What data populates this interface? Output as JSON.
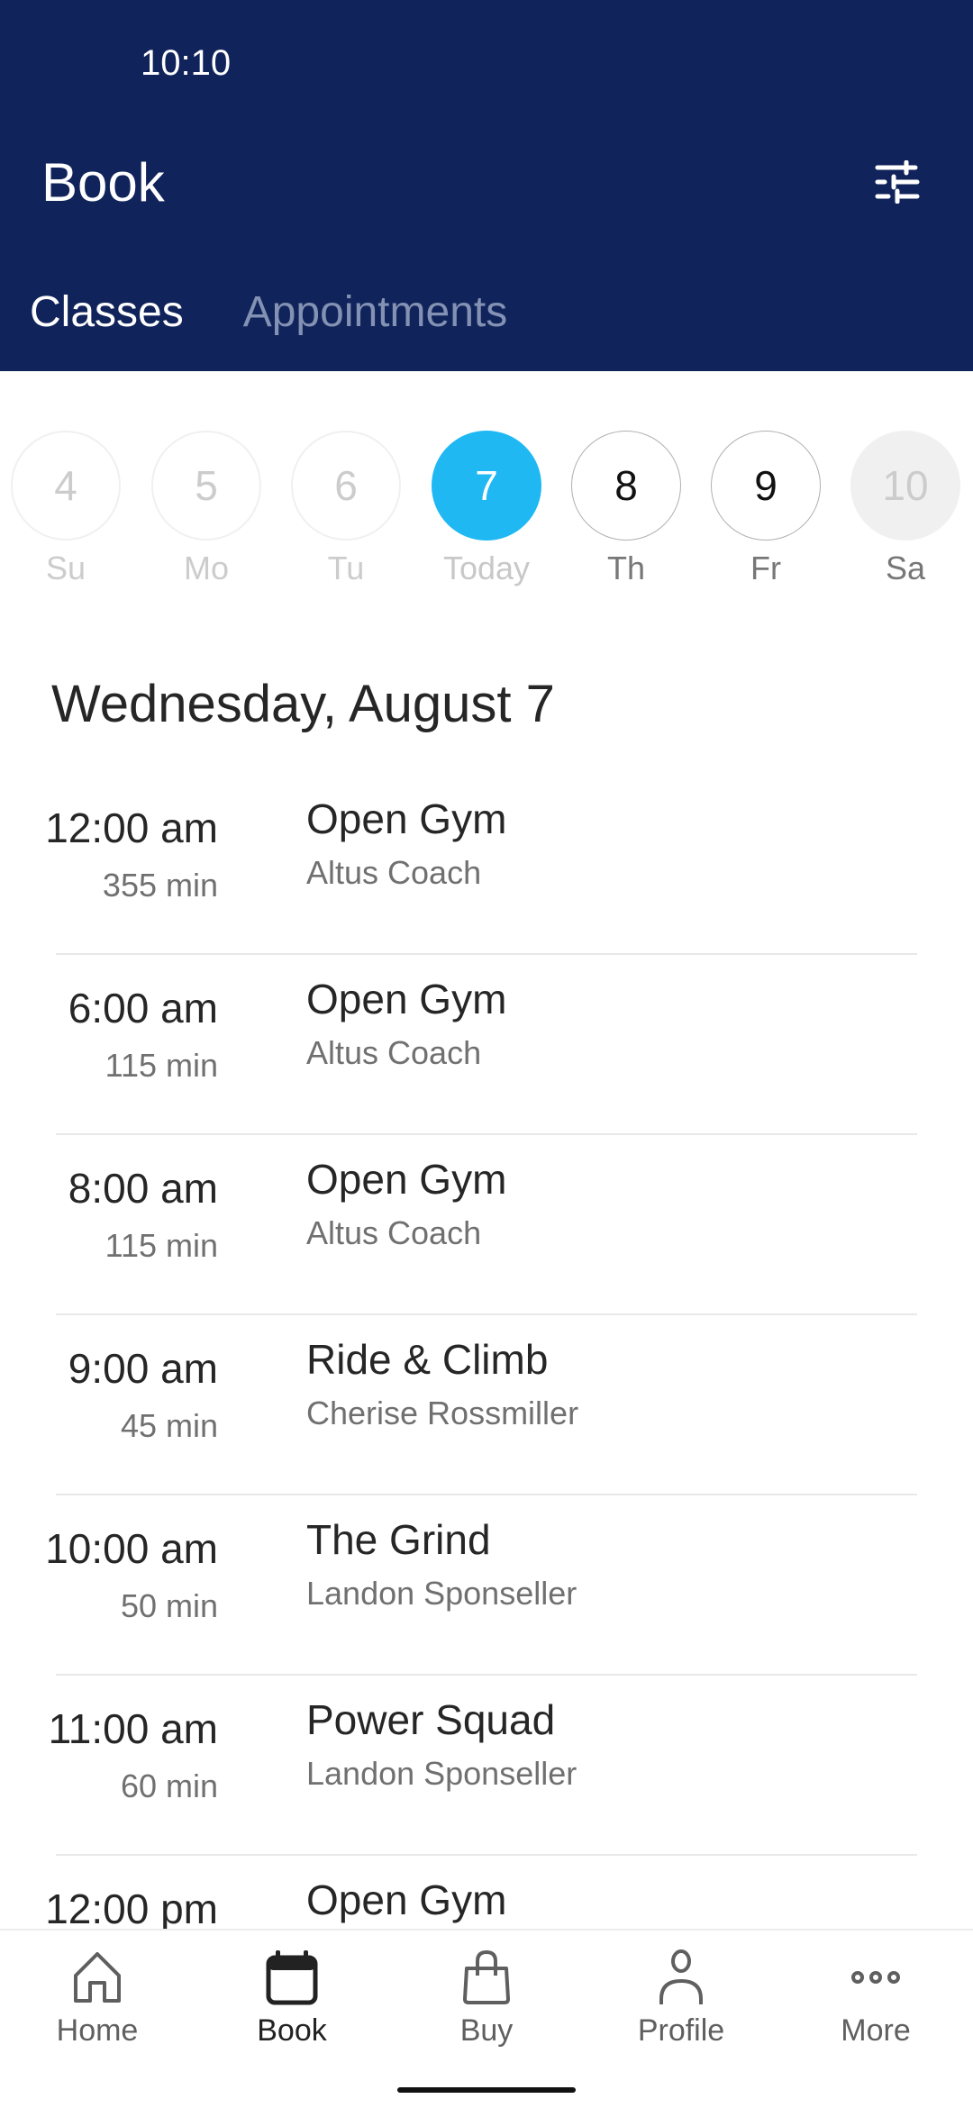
{
  "status_bar": {
    "time": "10:10"
  },
  "header": {
    "title": "Book",
    "filter_icon": "sliders-icon",
    "background_color": "#10235A"
  },
  "tabs": [
    {
      "label": "Classes",
      "active": true
    },
    {
      "label": "Appointments",
      "active": false
    }
  ],
  "date_strip": {
    "accent_color": "#1FB8F3",
    "days": [
      {
        "number": "4",
        "label": "Su",
        "state": "past"
      },
      {
        "number": "5",
        "label": "Mo",
        "state": "past"
      },
      {
        "number": "6",
        "label": "Tu",
        "state": "past"
      },
      {
        "number": "7",
        "label": "Today",
        "state": "today"
      },
      {
        "number": "8",
        "label": "Th",
        "state": "future"
      },
      {
        "number": "9",
        "label": "Fr",
        "state": "future"
      },
      {
        "number": "10",
        "label": "Sa",
        "state": "disabled"
      }
    ]
  },
  "schedule": {
    "date_heading": "Wednesday, August 7",
    "classes": [
      {
        "time": "12:00 am",
        "duration": "355 min",
        "name": "Open Gym",
        "instructor": "Altus Coach"
      },
      {
        "time": "6:00 am",
        "duration": "115 min",
        "name": "Open Gym",
        "instructor": "Altus Coach"
      },
      {
        "time": "8:00 am",
        "duration": "115 min",
        "name": "Open Gym",
        "instructor": "Altus Coach"
      },
      {
        "time": "9:00 am",
        "duration": "45 min",
        "name": "Ride & Climb",
        "instructor": "Cherise Rossmiller"
      },
      {
        "time": "10:00 am",
        "duration": "50 min",
        "name": "The Grind",
        "instructor": "Landon Sponseller"
      },
      {
        "time": "11:00 am",
        "duration": "60 min",
        "name": "Power Squad",
        "instructor": "Landon Sponseller"
      },
      {
        "time": "12:00 pm",
        "duration": "",
        "name": "Open Gym",
        "instructor": ""
      }
    ]
  },
  "bottom_nav": {
    "items": [
      {
        "label": "Home",
        "icon": "home-icon",
        "active": false
      },
      {
        "label": "Book",
        "icon": "calendar-icon",
        "active": true
      },
      {
        "label": "Buy",
        "icon": "shopping-bag-icon",
        "active": false
      },
      {
        "label": "Profile",
        "icon": "person-icon",
        "active": false
      },
      {
        "label": "More",
        "icon": "more-dots-icon",
        "active": false
      }
    ]
  }
}
